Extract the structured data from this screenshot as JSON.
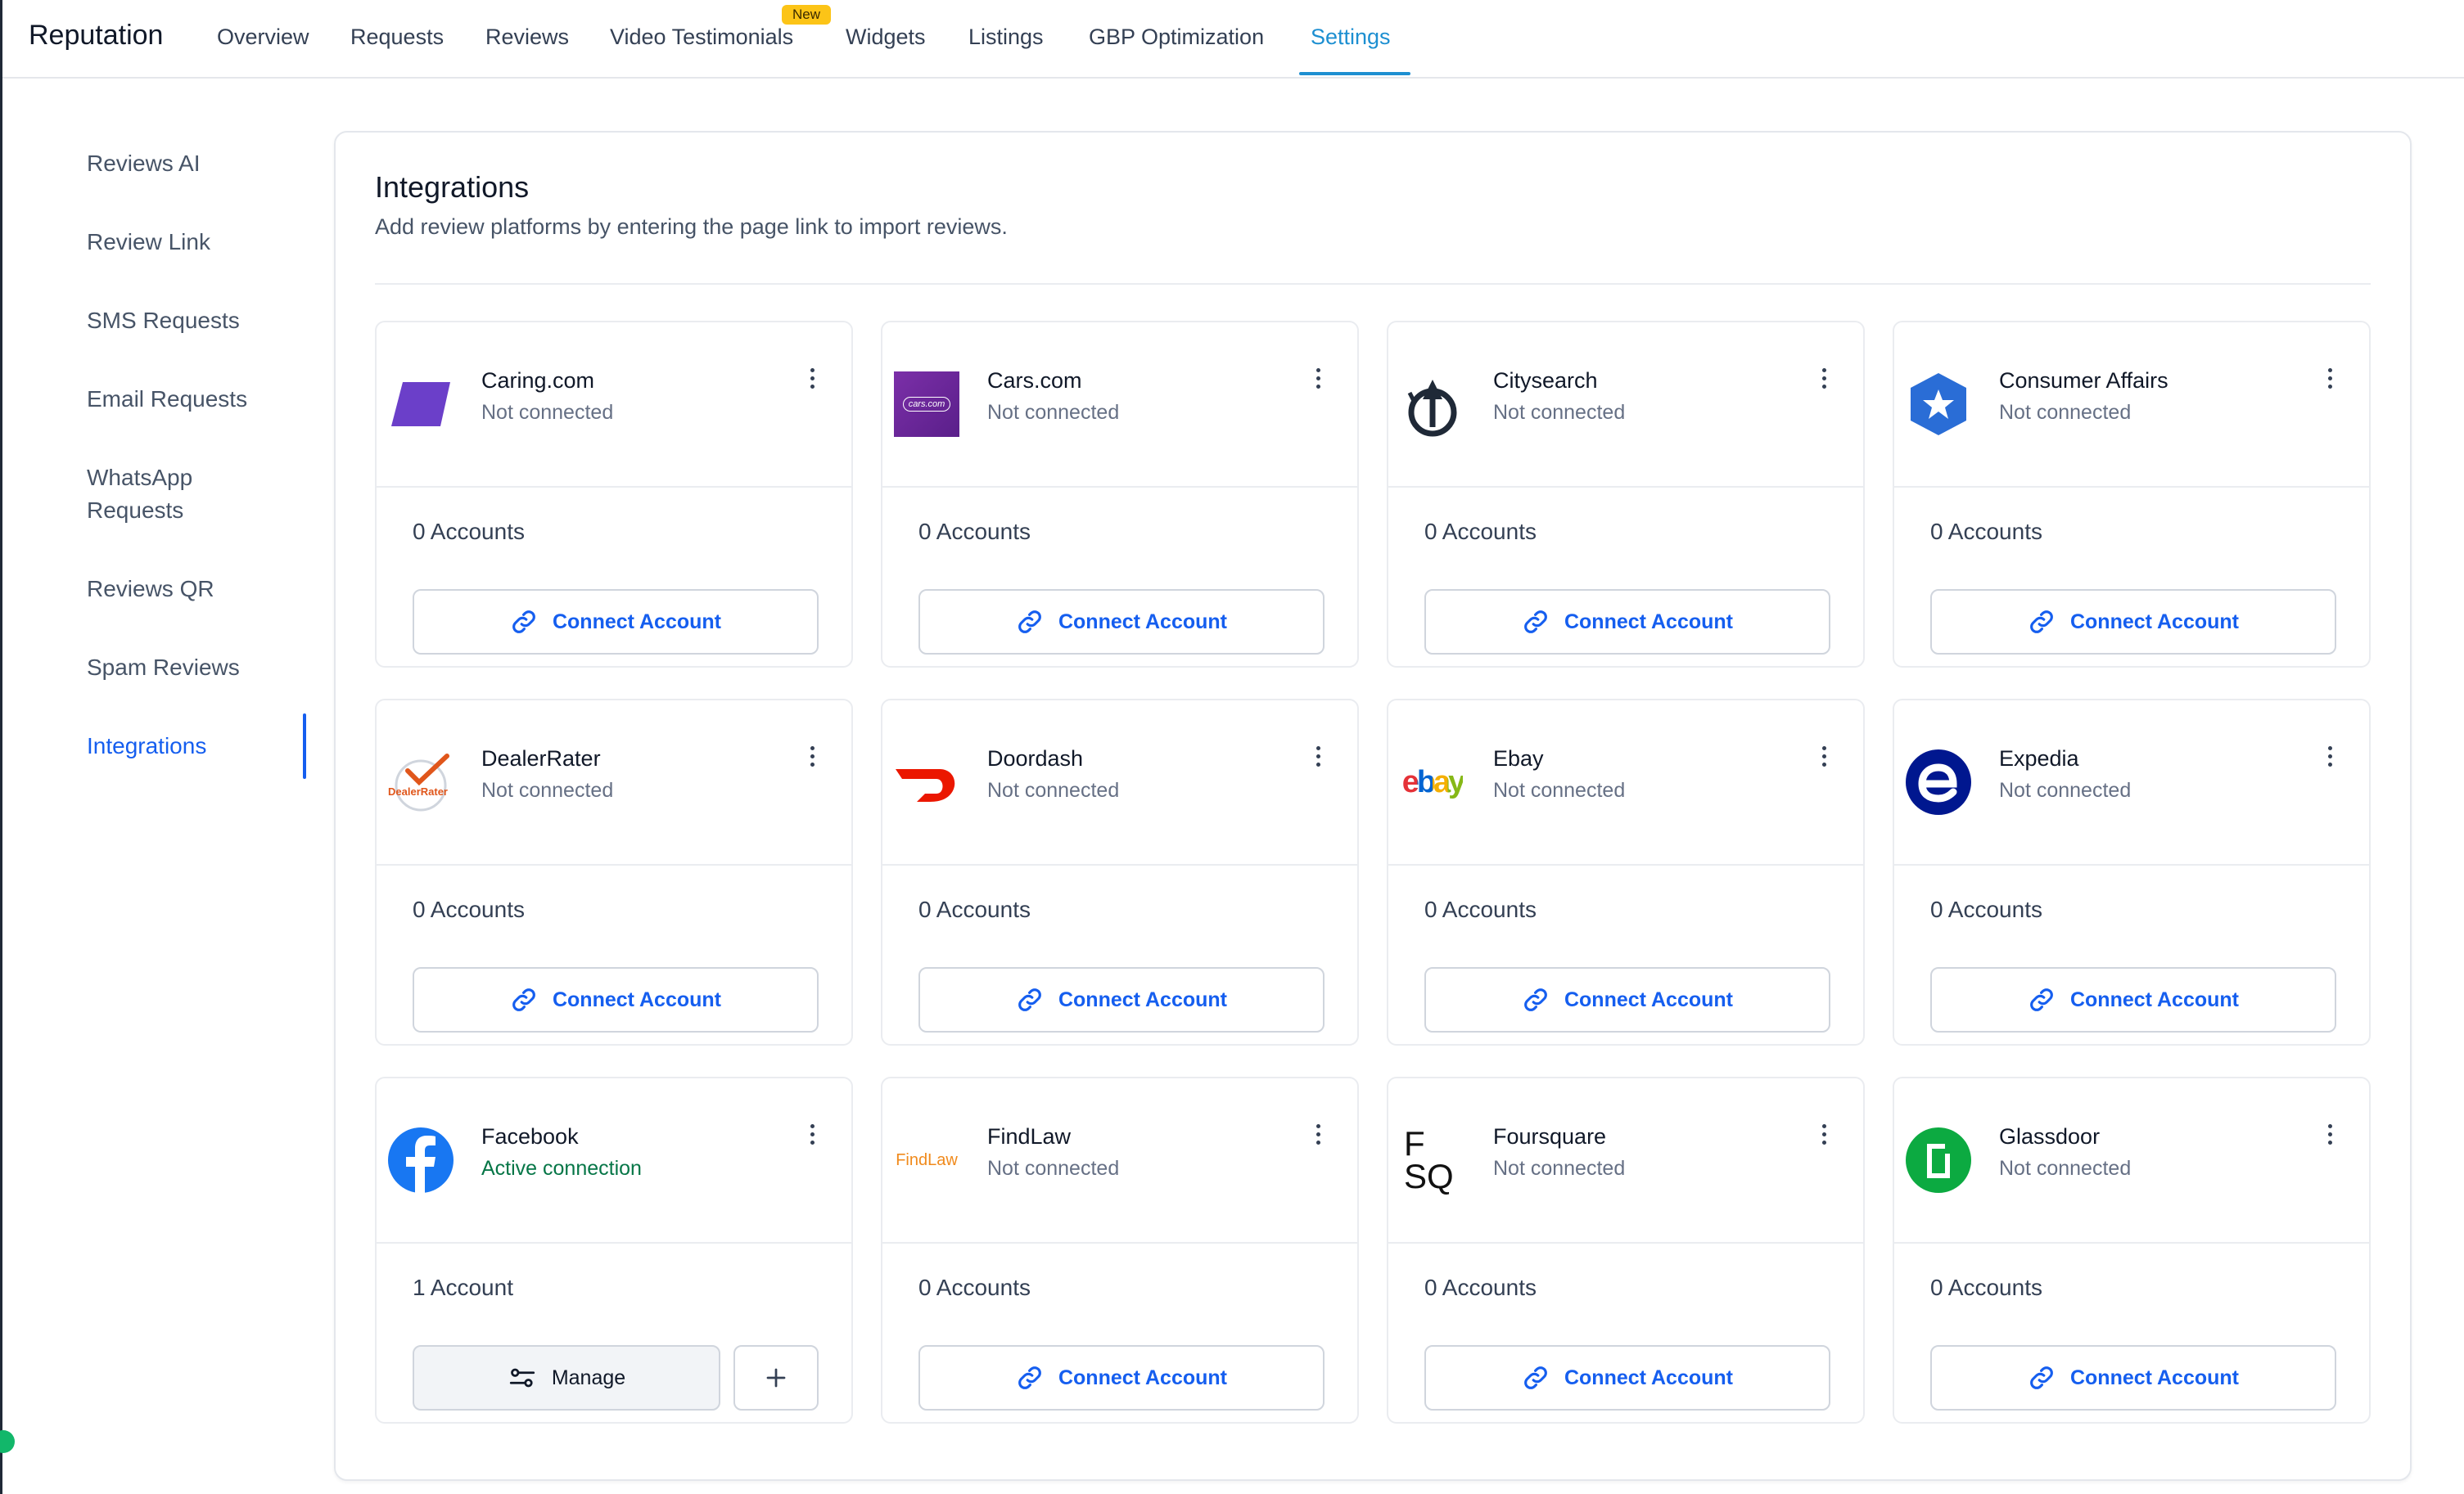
{
  "app": {
    "title": "Reputation"
  },
  "nav": {
    "tabs": [
      {
        "label": "Overview"
      },
      {
        "label": "Requests"
      },
      {
        "label": "Reviews"
      },
      {
        "label": "Video Testimonials",
        "badge": "New"
      },
      {
        "label": "Widgets"
      },
      {
        "label": "Listings"
      },
      {
        "label": "GBP Optimization"
      },
      {
        "label": "Settings",
        "active": true
      }
    ]
  },
  "sidebar": {
    "items": [
      {
        "label": "Reviews AI"
      },
      {
        "label": "Review Link"
      },
      {
        "label": "SMS Requests"
      },
      {
        "label": "Email Requests"
      },
      {
        "label": "WhatsApp",
        "label2": "Requests"
      },
      {
        "label": "Reviews QR"
      },
      {
        "label": "Spam Reviews"
      },
      {
        "label": "Integrations",
        "active": true
      }
    ]
  },
  "panel": {
    "title": "Integrations",
    "subtitle": "Add review platforms by entering the page link to import reviews."
  },
  "colors": {
    "accent": "#155eef",
    "nav_active": "#1d8fd1",
    "active_status": "#067647",
    "badge": "#fcc417"
  },
  "integrations": [
    {
      "name": "Caring.com",
      "status": "Not connected",
      "accounts": "0 Accounts",
      "action": "Connect Account",
      "icon": "caring-logo-icon"
    },
    {
      "name": "Cars.com",
      "status": "Not connected",
      "accounts": "0 Accounts",
      "action": "Connect Account",
      "icon": "cars-logo-icon",
      "logo_text": "cars.com"
    },
    {
      "name": "Citysearch",
      "status": "Not connected",
      "accounts": "0 Accounts",
      "action": "Connect Account",
      "icon": "citysearch-logo-icon"
    },
    {
      "name": "Consumer Affairs",
      "status": "Not connected",
      "accounts": "0 Accounts",
      "action": "Connect Account",
      "icon": "consumer-affairs-logo-icon"
    },
    {
      "name": "DealerRater",
      "status": "Not connected",
      "accounts": "0 Accounts",
      "action": "Connect Account",
      "icon": "dealerrater-logo-icon",
      "logo_text": "DealerRater"
    },
    {
      "name": "Doordash",
      "status": "Not connected",
      "accounts": "0 Accounts",
      "action": "Connect Account",
      "icon": "doordash-logo-icon"
    },
    {
      "name": "Ebay",
      "status": "Not connected",
      "accounts": "0 Accounts",
      "action": "Connect Account",
      "icon": "ebay-logo-icon",
      "logo_text": "ebay"
    },
    {
      "name": "Expedia",
      "status": "Not connected",
      "accounts": "0 Accounts",
      "action": "Connect Account",
      "icon": "expedia-logo-icon"
    },
    {
      "name": "Facebook",
      "status": "Active connection",
      "accounts": "1 Account",
      "action": "Manage",
      "icon": "facebook-logo-icon"
    },
    {
      "name": "FindLaw",
      "status": "Not connected",
      "accounts": "0 Accounts",
      "action": "Connect Account",
      "icon": "findlaw-logo-icon",
      "logo_text": "FindLaw"
    },
    {
      "name": "Foursquare",
      "status": "Not connected",
      "accounts": "0 Accounts",
      "action": "Connect Account",
      "icon": "foursquare-logo-icon",
      "logo_text": "F SQ"
    },
    {
      "name": "Glassdoor",
      "status": "Not connected",
      "accounts": "0 Accounts",
      "action": "Connect Account",
      "icon": "glassdoor-logo-icon"
    }
  ]
}
